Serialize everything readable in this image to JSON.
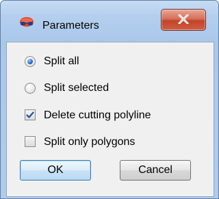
{
  "window": {
    "title": "Parameters",
    "close_symbol": "X"
  },
  "options": {
    "split_all": {
      "label": "Split all",
      "selected": true
    },
    "split_selected": {
      "label": "Split selected",
      "selected": false
    },
    "delete_cutting_polyline": {
      "label": "Delete cutting polyline",
      "checked": true
    },
    "split_only_polygons": {
      "label": "Split only polygons",
      "checked": false
    }
  },
  "buttons": {
    "ok_label": "OK",
    "cancel_label": "Cancel"
  },
  "icons": {
    "app": "glasses-icon",
    "close": "close-icon",
    "radio": "radio-icon",
    "check": "checkmark-icon"
  },
  "colors": {
    "close_button": "#c2432b",
    "default_button_border": "#3c7fb1",
    "radio_dot": "#2a6fc4"
  }
}
